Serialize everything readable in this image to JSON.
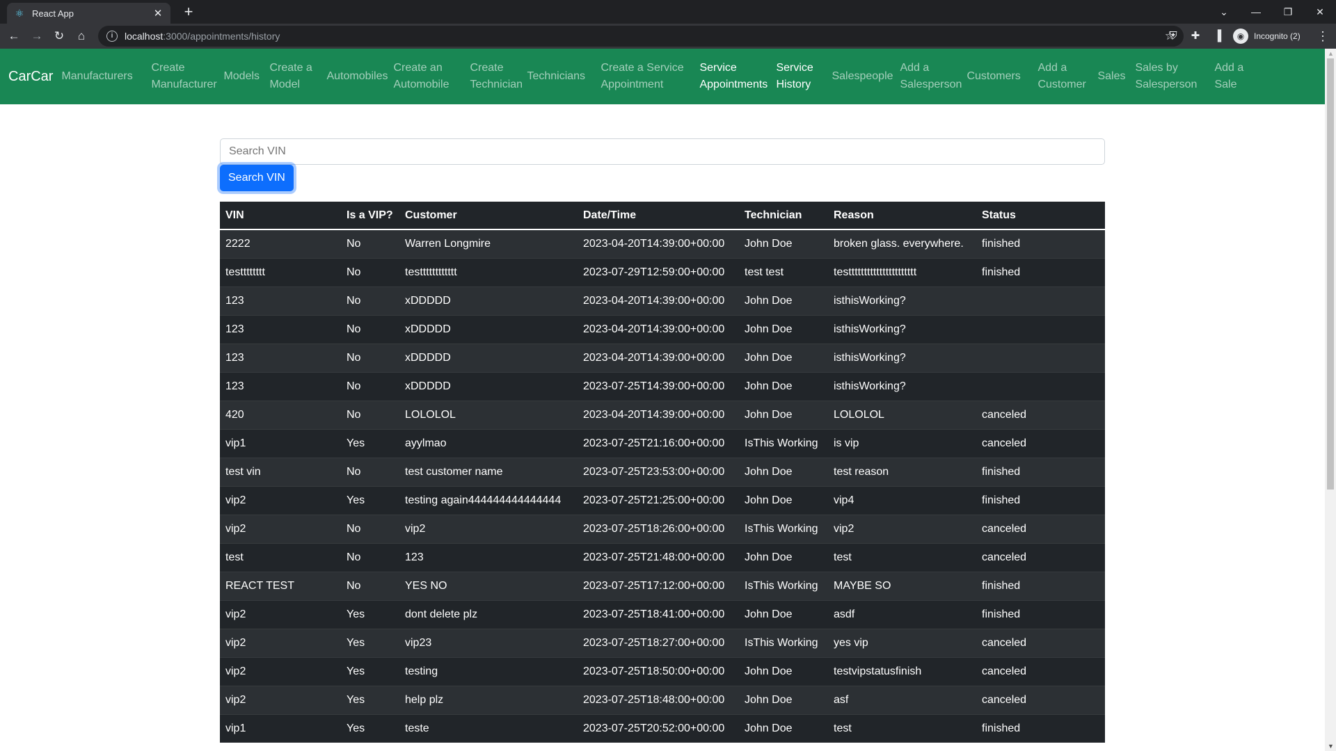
{
  "browser": {
    "tab_title": "React App",
    "url_host": "localhost",
    "url_path": ":3000/appointments/history",
    "profile_label": "Incognito (2)"
  },
  "navbar": {
    "brand": "CarCar",
    "links": [
      [
        "Manufacturers"
      ],
      [
        "Create",
        "Manufacturer"
      ],
      [
        "Models"
      ],
      [
        "Create a",
        "Model"
      ],
      [
        "Automobiles"
      ],
      [
        "Create an",
        "Automobile"
      ],
      [
        "Create",
        "Technician"
      ],
      [
        "Technicians"
      ],
      [
        "Create a Service",
        "Appointment"
      ],
      [
        "Service",
        "Appointments"
      ],
      [
        "Service",
        "History"
      ],
      [
        "Salespeople"
      ],
      [
        "Add a",
        "Salesperson"
      ],
      [
        "Customers"
      ],
      [
        "Add a",
        "Customer"
      ],
      [
        "Sales"
      ],
      [
        "Sales by",
        "Salesperson"
      ],
      [
        "Add a",
        "Sale"
      ]
    ],
    "active_indexes": [
      9,
      10
    ]
  },
  "search": {
    "placeholder": "Search VIN",
    "button_label": "Search VIN"
  },
  "table": {
    "headers": [
      "VIN",
      "Is a VIP?",
      "Customer",
      "Date/Time",
      "Technician",
      "Reason",
      "Status"
    ],
    "rows": [
      [
        "2222",
        "No",
        "Warren Longmire",
        "2023-04-20T14:39:00+00:00",
        "John Doe",
        "broken glass. everywhere.",
        "finished"
      ],
      [
        "testttttttt",
        "No",
        "testttttttttttt",
        "2023-07-29T12:59:00+00:00",
        "test test",
        "testttttttttttttttttttttt",
        "finished"
      ],
      [
        "123",
        "No",
        "xDDDDD",
        "2023-04-20T14:39:00+00:00",
        "John Doe",
        "isthisWorking?",
        ""
      ],
      [
        "123",
        "No",
        "xDDDDD",
        "2023-04-20T14:39:00+00:00",
        "John Doe",
        "isthisWorking?",
        ""
      ],
      [
        "123",
        "No",
        "xDDDDD",
        "2023-04-20T14:39:00+00:00",
        "John Doe",
        "isthisWorking?",
        ""
      ],
      [
        "123",
        "No",
        "xDDDDD",
        "2023-07-25T14:39:00+00:00",
        "John Doe",
        "isthisWorking?",
        ""
      ],
      [
        "420",
        "No",
        "LOLOLOL",
        "2023-04-20T14:39:00+00:00",
        "John Doe",
        "LOLOLOL",
        "canceled"
      ],
      [
        "vip1",
        "Yes",
        "ayylmao",
        "2023-07-25T21:16:00+00:00",
        "IsThis Working",
        "is vip",
        "canceled"
      ],
      [
        "test vin",
        "No",
        "test customer name",
        "2023-07-25T23:53:00+00:00",
        "John Doe",
        "test reason",
        "finished"
      ],
      [
        "vip2",
        "Yes",
        "testing again444444444444444",
        "2023-07-25T21:25:00+00:00",
        "John Doe",
        "vip4",
        "finished"
      ],
      [
        "vip2",
        "No",
        "vip2",
        "2023-07-25T18:26:00+00:00",
        "IsThis Working",
        "vip2",
        "canceled"
      ],
      [
        "test",
        "No",
        "123",
        "2023-07-25T21:48:00+00:00",
        "John Doe",
        "test",
        "canceled"
      ],
      [
        "REACT TEST",
        "No",
        "YES NO",
        "2023-07-25T17:12:00+00:00",
        "IsThis Working",
        "MAYBE SO",
        "finished"
      ],
      [
        "vip2",
        "Yes",
        "dont delete plz",
        "2023-07-25T18:41:00+00:00",
        "John Doe",
        "asdf",
        "finished"
      ],
      [
        "vip2",
        "Yes",
        "vip23",
        "2023-07-25T18:27:00+00:00",
        "IsThis Working",
        "yes vip",
        "canceled"
      ],
      [
        "vip2",
        "Yes",
        "testing",
        "2023-07-25T18:50:00+00:00",
        "John Doe",
        "testvipstatusfinish",
        "canceled"
      ],
      [
        "vip2",
        "Yes",
        "help plz",
        "2023-07-25T18:48:00+00:00",
        "John Doe",
        "asf",
        "canceled"
      ],
      [
        "vip1",
        "Yes",
        "teste",
        "2023-07-25T20:52:00+00:00",
        "John Doe",
        "test",
        "finished"
      ]
    ]
  }
}
